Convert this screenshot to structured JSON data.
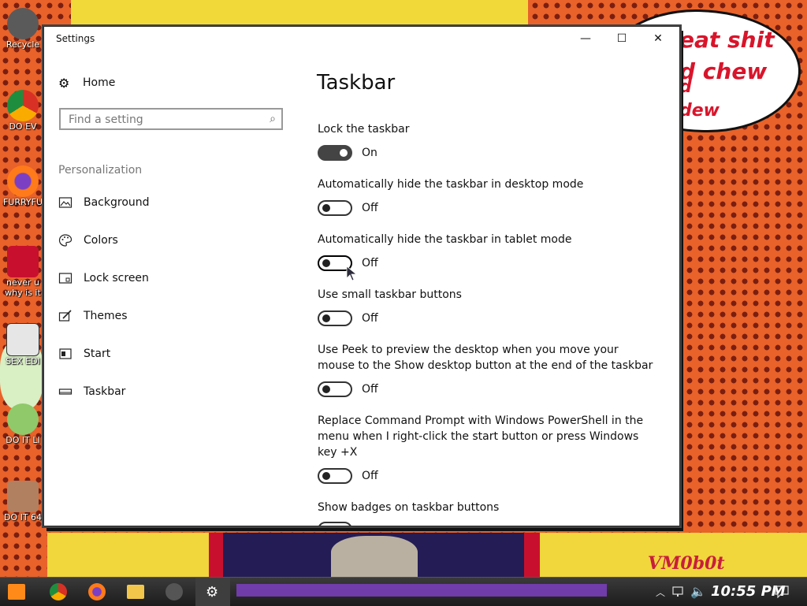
{
  "window": {
    "title": "Settings",
    "minimize_label": "—",
    "maximize_label": "☐",
    "close_label": "✕"
  },
  "sidebar": {
    "home_label": "Home",
    "home_icon": "gear-icon",
    "search_placeholder": "Find a setting",
    "search_icon": "search-icon",
    "section_label": "Personalization",
    "items": [
      {
        "label": "Background",
        "icon": "image-icon"
      },
      {
        "label": "Colors",
        "icon": "palette-icon"
      },
      {
        "label": "Lock screen",
        "icon": "lock-screen-icon"
      },
      {
        "label": "Themes",
        "icon": "brush-icon"
      },
      {
        "label": "Start",
        "icon": "start-icon"
      },
      {
        "label": "Taskbar",
        "icon": "taskbar-icon"
      }
    ]
  },
  "main": {
    "title": "Taskbar",
    "settings": [
      {
        "label": "Lock the taskbar",
        "state": "On",
        "on": true
      },
      {
        "label": "Automatically hide the taskbar in desktop mode",
        "state": "Off",
        "on": false
      },
      {
        "label": "Automatically hide the taskbar in tablet mode",
        "state": "Off",
        "on": false
      },
      {
        "label": "Use small taskbar buttons",
        "state": "Off",
        "on": false
      },
      {
        "label": "Use Peek to preview the desktop when you move your mouse to the Show desktop button at the end of the taskbar",
        "state": "Off",
        "on": false
      },
      {
        "label": "Replace Command Prompt with Windows PowerShell in the menu when I right-click the start button or press Windows key +X",
        "state": "Off",
        "on": false
      },
      {
        "label": "Show badges on taskbar buttons"
      }
    ]
  },
  "desktop": {
    "icons": [
      {
        "label": "Recycle",
        "color": "#5a5a5a"
      },
      {
        "label": "DO EV",
        "color": "#2d6ad6"
      },
      {
        "label": "FURRYFU",
        "color": "#e8622a"
      },
      {
        "label": "never u why is it",
        "color": "#c8102e"
      },
      {
        "label": "SEX EDI",
        "color": "#2b2b2b"
      },
      {
        "label": "DO IT LI",
        "color": "#8fc96a"
      },
      {
        "label": "DO IT 64",
        "color": "#b08060"
      }
    ],
    "bubble_lines": [
      "eat shit",
      "d chew",
      "d",
      "dew"
    ],
    "wallpaper_signature": "VM0b0t"
  },
  "taskbar": {
    "clock": "10:55 PM",
    "apps": [
      "start-icon",
      "chrome-icon",
      "firefox-icon",
      "file-explorer-icon",
      "app-icon",
      "settings-icon"
    ],
    "tray_icons": [
      "chevron-up-icon",
      "network-icon",
      "volume-icon",
      "notifications-icon"
    ]
  },
  "colors": {
    "toggle_on": "#444444",
    "desktop_bg": "#e8622a",
    "accent_purple": "#7c3fc0"
  }
}
